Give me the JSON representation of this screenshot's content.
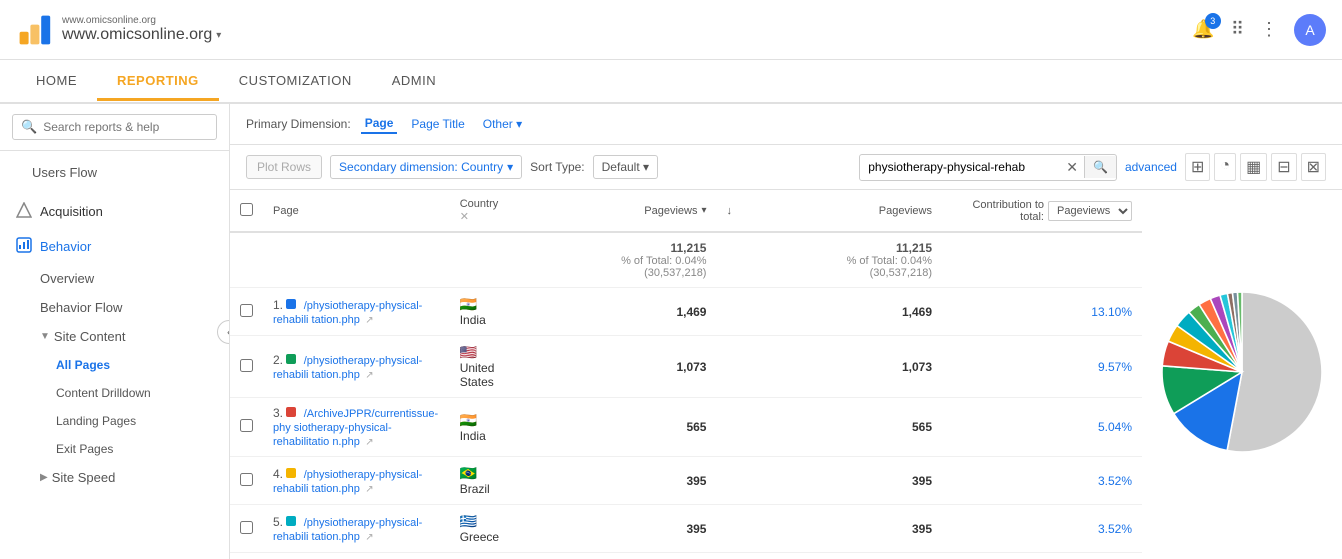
{
  "topbar": {
    "site_url_small": "www.omicsonline.org",
    "site_name": "www.omicsonline.org",
    "dropdown_arrow": "▾",
    "notification_count": "3",
    "avatar_letter": "A"
  },
  "navbar": {
    "items": [
      {
        "label": "HOME",
        "active": false
      },
      {
        "label": "REPORTING",
        "active": true
      },
      {
        "label": "CUSTOMIZATION",
        "active": false
      },
      {
        "label": "ADMIN",
        "active": false
      }
    ]
  },
  "sidebar": {
    "search_placeholder": "Search reports & help",
    "items": [
      {
        "label": "Users Flow",
        "icon": "👥",
        "indent": 1
      },
      {
        "label": "Acquisition",
        "icon": "📥",
        "indent": 0
      },
      {
        "label": "Behavior",
        "icon": "📊",
        "indent": 0,
        "active": true
      },
      {
        "label": "Overview",
        "indent": 2
      },
      {
        "label": "Behavior Flow",
        "indent": 2
      },
      {
        "label": "▼ Site Content",
        "indent": 2,
        "expanded": true
      },
      {
        "label": "All Pages",
        "indent": 3,
        "active": true
      },
      {
        "label": "Content Drilldown",
        "indent": 3
      },
      {
        "label": "Landing Pages",
        "indent": 3
      },
      {
        "label": "Exit Pages",
        "indent": 3
      },
      {
        "label": "▶ Site Speed",
        "indent": 2
      }
    ]
  },
  "filters": {
    "primary_dim_label": "Primary Dimension:",
    "dims": [
      {
        "label": "Page",
        "active": true
      },
      {
        "label": "Page Title",
        "active": false
      },
      {
        "label": "Other ▾",
        "active": false
      }
    ]
  },
  "toolbar": {
    "plot_rows_label": "Plot Rows",
    "secondary_dim_label": "Secondary dimension: Country",
    "sort_label": "Sort Type:",
    "sort_value": "Default ▾",
    "search_value": "physiotherapy-physical-rehab",
    "advanced_label": "advanced"
  },
  "table": {
    "columns": [
      {
        "label": "Page"
      },
      {
        "label": "Country ✕"
      },
      {
        "label": "Pageviews ▾",
        "align": "right"
      },
      {
        "label": "↓",
        "align": "right"
      },
      {
        "label": "Pageviews",
        "align": "right"
      },
      {
        "label": "Contribution to total:",
        "select": "Pageviews",
        "align": "right"
      }
    ],
    "summary": {
      "pageviews": "11,215",
      "percent": "% of Total: 0.04%",
      "total": "(30,537,218)",
      "pageviews2": "11,215",
      "percent2": "% of Total: 0.04%",
      "total2": "(30,537,218)"
    },
    "rows": [
      {
        "num": "1.",
        "page": "/physiotherapy-physical-rehabili tation.php",
        "color": "#1a73e8",
        "flag": "🇮🇳",
        "country": "India",
        "pageviews": "1,469",
        "contrib": "13.10%"
      },
      {
        "num": "2.",
        "page": "/physiotherapy-physical-rehabili tation.php",
        "color": "#0f9d58",
        "flag": "🇺🇸",
        "country": "United States",
        "pageviews": "1,073",
        "contrib": "9.57%"
      },
      {
        "num": "3.",
        "page": "/ArchiveJPPR/currentissue-phy siotherapy-physical-rehabilitatio n.php",
        "color": "#db4437",
        "flag": "🇮🇳",
        "country": "India",
        "pageviews": "565",
        "contrib": "5.04%"
      },
      {
        "num": "4.",
        "page": "/physiotherapy-physical-rehabili tation.php",
        "color": "#f4b400",
        "flag": "🇧🇷",
        "country": "Brazil",
        "pageviews": "395",
        "contrib": "3.52%"
      },
      {
        "num": "5.",
        "page": "/physiotherapy-physical-rehabili tation.php",
        "color": "#00acc1",
        "flag": "🇬🇷",
        "country": "Greece",
        "pageviews": "395",
        "contrib": "3.52%"
      }
    ]
  },
  "pie_chart": {
    "segments": [
      {
        "label": "52.2%",
        "color": "#cccccc",
        "pct": 52.2
      },
      {
        "label": "13.1%",
        "color": "#1a73e8",
        "pct": 13.1
      },
      {
        "label": "9.8%",
        "color": "#0f9d58",
        "pct": 9.8
      },
      {
        "label": "5%",
        "color": "#db4437",
        "pct": 5
      },
      {
        "label": "",
        "color": "#f4b400",
        "pct": 3.52
      },
      {
        "label": "",
        "color": "#00acc1",
        "pct": 3.52
      },
      {
        "label": "",
        "color": "#4caf50",
        "pct": 2.5
      },
      {
        "label": "",
        "color": "#ff7043",
        "pct": 2.5
      },
      {
        "label": "",
        "color": "#ab47bc",
        "pct": 2.0
      },
      {
        "label": "",
        "color": "#26c6da",
        "pct": 1.5
      },
      {
        "label": "",
        "color": "#8d6e63",
        "pct": 1.0
      },
      {
        "label": "",
        "color": "#78909c",
        "pct": 1.0
      },
      {
        "label": "",
        "color": "#66bb6a",
        "pct": 0.88
      }
    ]
  }
}
